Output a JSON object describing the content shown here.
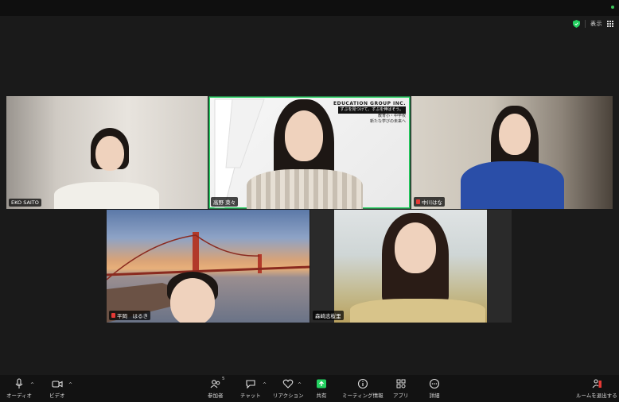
{
  "window": {
    "view_label": "表示"
  },
  "participants": [
    {
      "name": "EKO SAITO",
      "mic_muted": false
    },
    {
      "name": "高野 菜々",
      "mic_muted": false,
      "active_speaker": true
    },
    {
      "name": "中川はな",
      "mic_muted": true
    },
    {
      "name": "平岡　はるき",
      "mic_muted": true
    },
    {
      "name": "森崎志桜里",
      "mic_muted": false
    }
  ],
  "virtual_background_text": {
    "line1": "EDUCATION GROUP INC.",
    "line2": "ずぶを見つけて、ずぶを伸ばそう。",
    "line3": "教育小・中学校",
    "line4": "新たな学びの未来へ"
  },
  "toolbar": {
    "audio_label": "オーディオ",
    "video_label": "ビデオ",
    "participants_label": "参加者",
    "participants_count": "5",
    "chat_label": "チャット",
    "reactions_label": "リアクション",
    "share_label": "共有",
    "info_label": "ミーティング情報",
    "apps_label": "アプリ",
    "more_label": "詳細",
    "leave_label": "ルームを退出する"
  },
  "colors": {
    "active_speaker_outline": "#23d160",
    "share_green": "#23d160",
    "muted_red": "#e53935",
    "leave_red": "#e53935"
  }
}
